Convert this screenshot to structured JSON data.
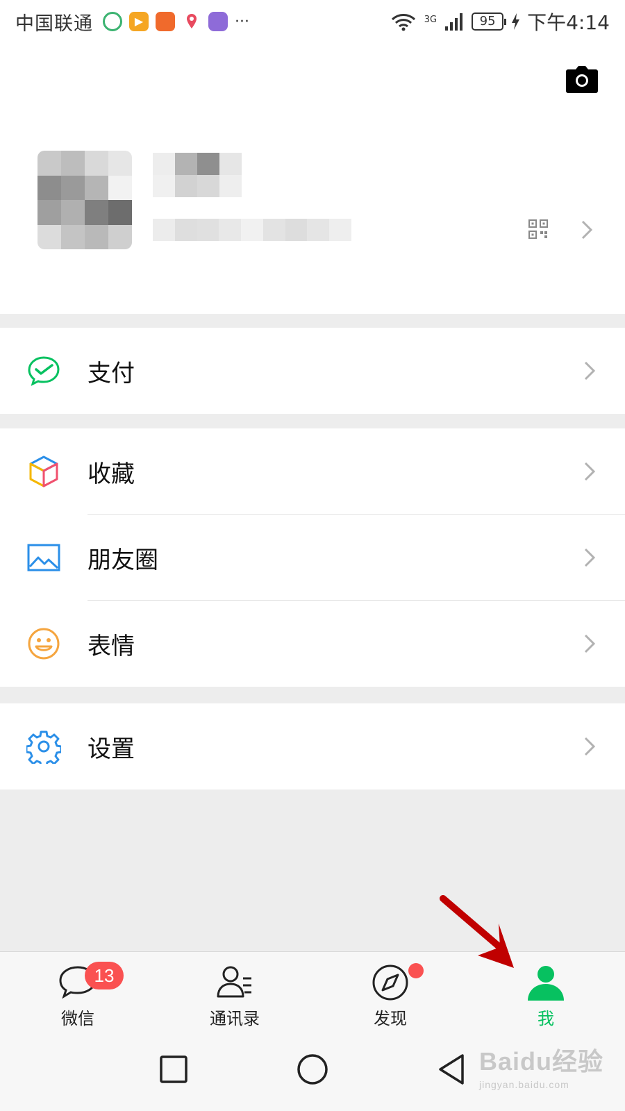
{
  "status_bar": {
    "carrier": "中国联通",
    "more_indicator": "···",
    "network_type": "3G",
    "battery_level": "95",
    "time": "下午4:14",
    "notification_icons": [
      "photos-app-icon",
      "video-app-icon",
      "bank-app-icon",
      "maps-app-icon",
      "clock-app-icon"
    ]
  },
  "profile": {
    "camera_icon": "camera-icon",
    "qr_icon": "qr-code-icon"
  },
  "menu": {
    "pay": {
      "label": "支付",
      "icon": "wechat-pay-icon"
    },
    "favorites": {
      "label": "收藏",
      "icon": "favorites-cube-icon"
    },
    "moments": {
      "label": "朋友圈",
      "icon": "moments-picture-icon"
    },
    "stickers": {
      "label": "表情",
      "icon": "smiley-icon"
    },
    "settings": {
      "label": "设置",
      "icon": "gear-icon"
    }
  },
  "tabbar": {
    "tabs": [
      {
        "label": "微信",
        "icon": "chat-bubble-icon",
        "badge": "13"
      },
      {
        "label": "通讯录",
        "icon": "contacts-icon"
      },
      {
        "label": "发现",
        "icon": "compass-icon",
        "dot": true
      },
      {
        "label": "我",
        "icon": "person-icon",
        "active": true
      }
    ]
  },
  "colors": {
    "accent_green": "#07c160",
    "badge_red": "#fa5151",
    "background": "#ededed",
    "annotation_arrow": "#c00000"
  },
  "watermark": {
    "brand": "Baidu经验",
    "url": "jingyan.baidu.com"
  }
}
